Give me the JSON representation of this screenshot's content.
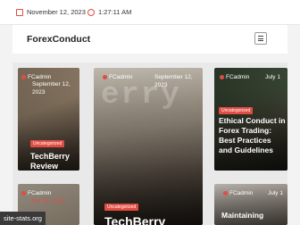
{
  "topbar": {
    "date": "November 12, 2023",
    "time": "1:27:11 AM"
  },
  "header": {
    "brand": "ForexConduct"
  },
  "cards": [
    {
      "author": "FCadmin",
      "date": "September 12, 2023",
      "badge": "Uncategorized",
      "title": "TechBerry Review"
    },
    {
      "author": "FCadmin",
      "date": "September 12, 2023",
      "badge": "Uncategorized",
      "title": "TechBerry",
      "watermark": "erry"
    },
    {
      "author": "FCadmin",
      "date": "July 1",
      "badge": "Uncategorized",
      "title": "Ethical Conduct in Forex Trading: Best Practices and Guidelines"
    },
    {
      "author": "FCadmin",
      "date": "July 26, 2023",
      "badge": ""
    },
    {
      "author": "FCadmin",
      "date": "July 1",
      "title": "Maintaining"
    }
  ],
  "footer": {
    "link": "site-stats.org"
  },
  "colors": {
    "accent": "#e14d43"
  }
}
